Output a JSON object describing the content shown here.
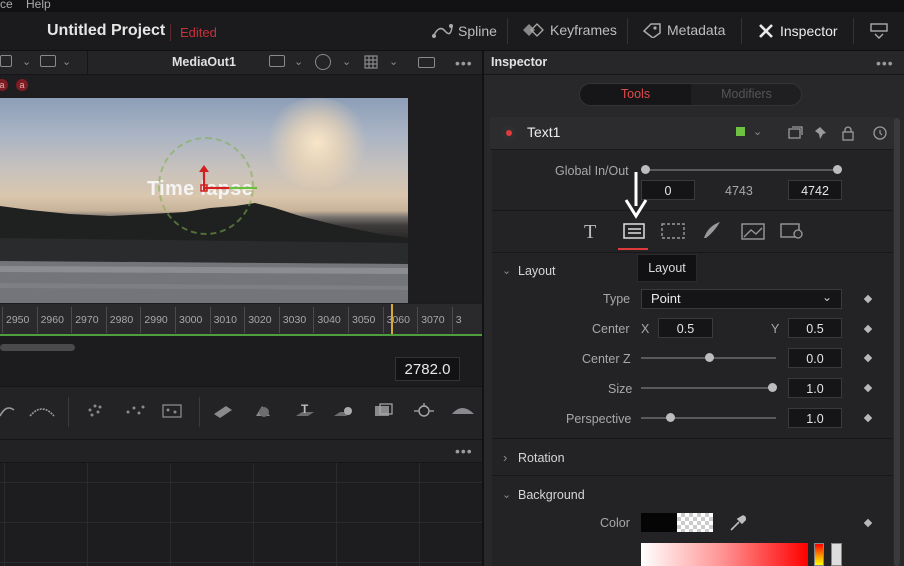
{
  "menu": {
    "items": [
      "ce",
      "Help"
    ]
  },
  "titlebar": {
    "project": "Untitled Project",
    "status": "Edited",
    "buttons": [
      {
        "label": "Spline",
        "icon": "spline-icon"
      },
      {
        "label": "Keyframes",
        "icon": "keyframes-icon"
      },
      {
        "label": "Metadata",
        "icon": "metadata-icon"
      },
      {
        "label": "Inspector",
        "icon": "inspector-icon"
      }
    ]
  },
  "viewer": {
    "title": "MediaOut1",
    "badges": [
      "a",
      "a"
    ],
    "overlay_text": "Time lapse",
    "ruler_ticks": [
      "2950",
      "2960",
      "2970",
      "2980",
      "2990",
      "3000",
      "3010",
      "3020",
      "3030",
      "3040",
      "3050",
      "3060",
      "3070",
      "3"
    ],
    "timecode": "2782.0"
  },
  "node_panel": {
    "more": "•••"
  },
  "inspector": {
    "title": "Inspector",
    "more": "•••",
    "tabs": {
      "tools": "Tools",
      "modifiers": "Modifiers"
    },
    "tool_name": "Text1",
    "global_label": "Global In/Out",
    "global_in": "0",
    "global_mid": "4743",
    "global_out": "4742",
    "tooltip": "Layout",
    "layout": {
      "section": "Layout",
      "type_label": "Type",
      "type_value": "Point",
      "center_label": "Center",
      "x_label": "X",
      "x_value": "0.5",
      "y_label": "Y",
      "y_value": "0.5",
      "centerz_label": "Center Z",
      "centerz_value": "0.0",
      "size_label": "Size",
      "size_value": "1.0",
      "perspective_label": "Perspective",
      "perspective_value": "1.0"
    },
    "rotation_section": "Rotation",
    "background_section": "Background",
    "color_label": "Color"
  },
  "colors": {
    "accent_red": "#e03a3a",
    "edited_red": "#c9303a",
    "node_green": "#6ec141",
    "playhead": "#d9a733"
  }
}
